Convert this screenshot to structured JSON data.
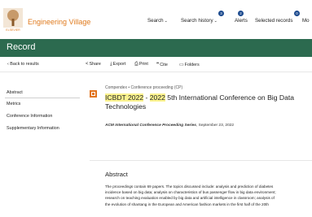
{
  "app": {
    "name": "Engineering Village",
    "publisher_mark": "ELSEVIER"
  },
  "nav": {
    "search": "Search",
    "search_history": "Search history",
    "search_history_count": "3",
    "alerts": "Alerts",
    "alerts_count": "2",
    "selected_records": "Selected records",
    "selected_records_count": "0",
    "more": "Mo"
  },
  "header": {
    "title": "Record"
  },
  "toolbar": {
    "back": "Back to results",
    "share": "Share",
    "export": "Export",
    "print": "Print",
    "cite": "Cite",
    "folders": "Folders"
  },
  "sidebar": {
    "items": [
      {
        "label": "Abstract"
      },
      {
        "label": "Metrics"
      },
      {
        "label": "Conference Information"
      },
      {
        "label": "Supplementary Information"
      }
    ]
  },
  "record": {
    "doc_type": "Compendex • Conference proceeding (CP)",
    "title_hl_1": "ICBDT 2022",
    "title_sep": " - ",
    "title_hl_2": "2022",
    "title_rest": " 5th International Conference on Big Data Technologies",
    "series_name": "ACM International Conference Proceeding Series",
    "series_date": ", September 23, 2022"
  },
  "abstract": {
    "heading": "Abstract",
    "line1": "The proceedings contain 69 papers. The topics discussed include: analysis and prediction of diabetes",
    "line2": "incidence based on big data; analysis on characteristics of bus passenger flow in big data environment;",
    "line3": "research on teaching evaluation enabled by big data and artificial intelligence in classroom; analysis of",
    "line4": "the evolution of shantang in the European and American fashion markets in the first half of the 20th"
  },
  "colors": {
    "brand_orange": "#e07b1f",
    "header_green": "#2c6a4f",
    "badge_blue": "#1c4a8e",
    "highlight": "#fbf38f"
  }
}
